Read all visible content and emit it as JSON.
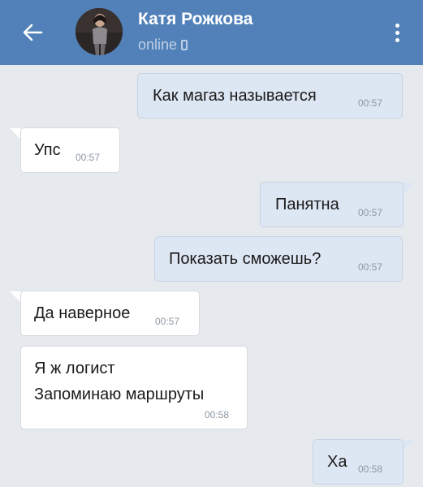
{
  "header": {
    "contact_name": "Катя Рожкова",
    "status": "online",
    "status_device_icon": "mobile-phone-icon",
    "back_icon": "arrow-left-icon",
    "menu_icon": "more-vertical-icon",
    "colors": {
      "bar": "#5181b8",
      "status_text": "#bfd0e6"
    }
  },
  "chat": {
    "background": "#e6e9ed",
    "messages": [
      {
        "direction": "outgoing",
        "text": "Как магаз называется",
        "time": "00:57"
      },
      {
        "direction": "incoming",
        "text": "Упс",
        "time": "00:57"
      },
      {
        "direction": "outgoing",
        "text": "Панятна",
        "time": "00:57"
      },
      {
        "direction": "outgoing",
        "text": "Показать сможешь?",
        "time": "00:57"
      },
      {
        "direction": "incoming",
        "text": "Да наверное",
        "time": "00:57"
      },
      {
        "direction": "incoming",
        "lines": [
          "Я ж логист",
          "Запоминаю маршруты"
        ],
        "time": "00:58"
      },
      {
        "direction": "outgoing",
        "text": "Ха",
        "time": "00:58"
      }
    ],
    "colors": {
      "incoming": "#ffffff",
      "outgoing": "#dde6f3",
      "time": "#8e98a3"
    }
  }
}
